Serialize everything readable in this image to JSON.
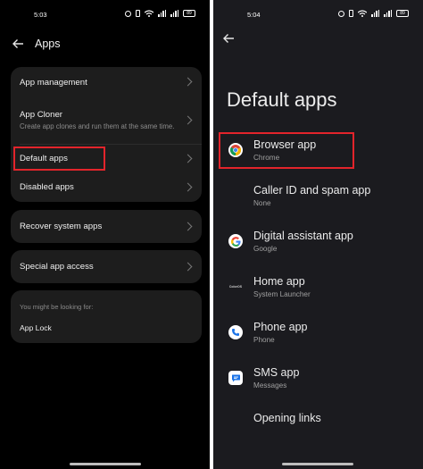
{
  "left_screen": {
    "status_time": "5:03",
    "battery": "89",
    "title": "Apps",
    "card1": {
      "rows": [
        {
          "title": "App management",
          "subtitle": ""
        },
        {
          "title": "App Cloner",
          "subtitle": "Create app clones and run them at the same time."
        },
        {
          "title": "Default apps",
          "subtitle": ""
        },
        {
          "title": "Disabled apps",
          "subtitle": ""
        }
      ]
    },
    "recover": "Recover system apps",
    "special": "Special app access",
    "hint": {
      "label": "You might be looking for:",
      "item": "App Lock"
    }
  },
  "right_screen": {
    "status_time": "5:04",
    "battery": "89",
    "title": "Default apps",
    "apps": [
      {
        "title": "Browser app",
        "subtitle": "Chrome",
        "icon": "chrome-icon"
      },
      {
        "title": "Caller ID and spam app",
        "subtitle": "None",
        "icon": ""
      },
      {
        "title": "Digital assistant app",
        "subtitle": "Google",
        "icon": "google-icon"
      },
      {
        "title": "Home app",
        "subtitle": "System Launcher",
        "icon": "coloros-launcher-icon",
        "icon_text": "ColorOS"
      },
      {
        "title": "Phone app",
        "subtitle": "Phone",
        "icon": "phone-icon"
      },
      {
        "title": "SMS app",
        "subtitle": "Messages",
        "icon": "messages-icon"
      },
      {
        "title": "Opening links",
        "subtitle": "",
        "icon": ""
      }
    ]
  },
  "colors": {
    "highlight": "#e3242b",
    "left_bg": "#000000",
    "right_bg": "#1b1b1f",
    "card_bg": "#1d1d1d",
    "phone_icon": "#1a73e8"
  }
}
